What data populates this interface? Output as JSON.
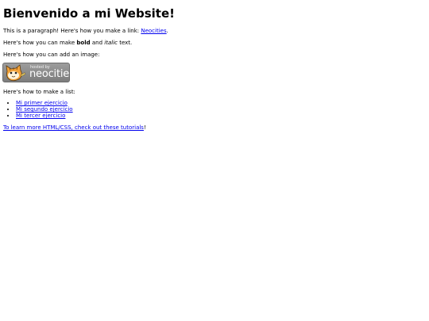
{
  "heading": "Bienvenido a mi Website!",
  "paragraph_link": {
    "before": "This is a paragraph! Here's how you make a link: ",
    "link": "Neocities",
    "after": "."
  },
  "paragraph_format": {
    "before": "Here's how you can make ",
    "bold": "bold",
    "middle": " and ",
    "italic": "italic",
    "after": " text."
  },
  "paragraph_image": "Here's how you can add an image:",
  "badge": {
    "hosted_text": "hosted by",
    "brand_text": "neocities",
    "background": "#8a8a8a"
  },
  "paragraph_list": "Here's how to make a list:",
  "list_items": [
    "Mi primer ejercicio",
    "Mi segundo ejercicio",
    "Mi tercer ejercicio"
  ],
  "tutorial": {
    "link": "To learn more HTML/CSS, check out these tutorials",
    "after": "!"
  },
  "colors": {
    "link": "#0000ee",
    "text": "#000000",
    "background": "#ffffff"
  }
}
